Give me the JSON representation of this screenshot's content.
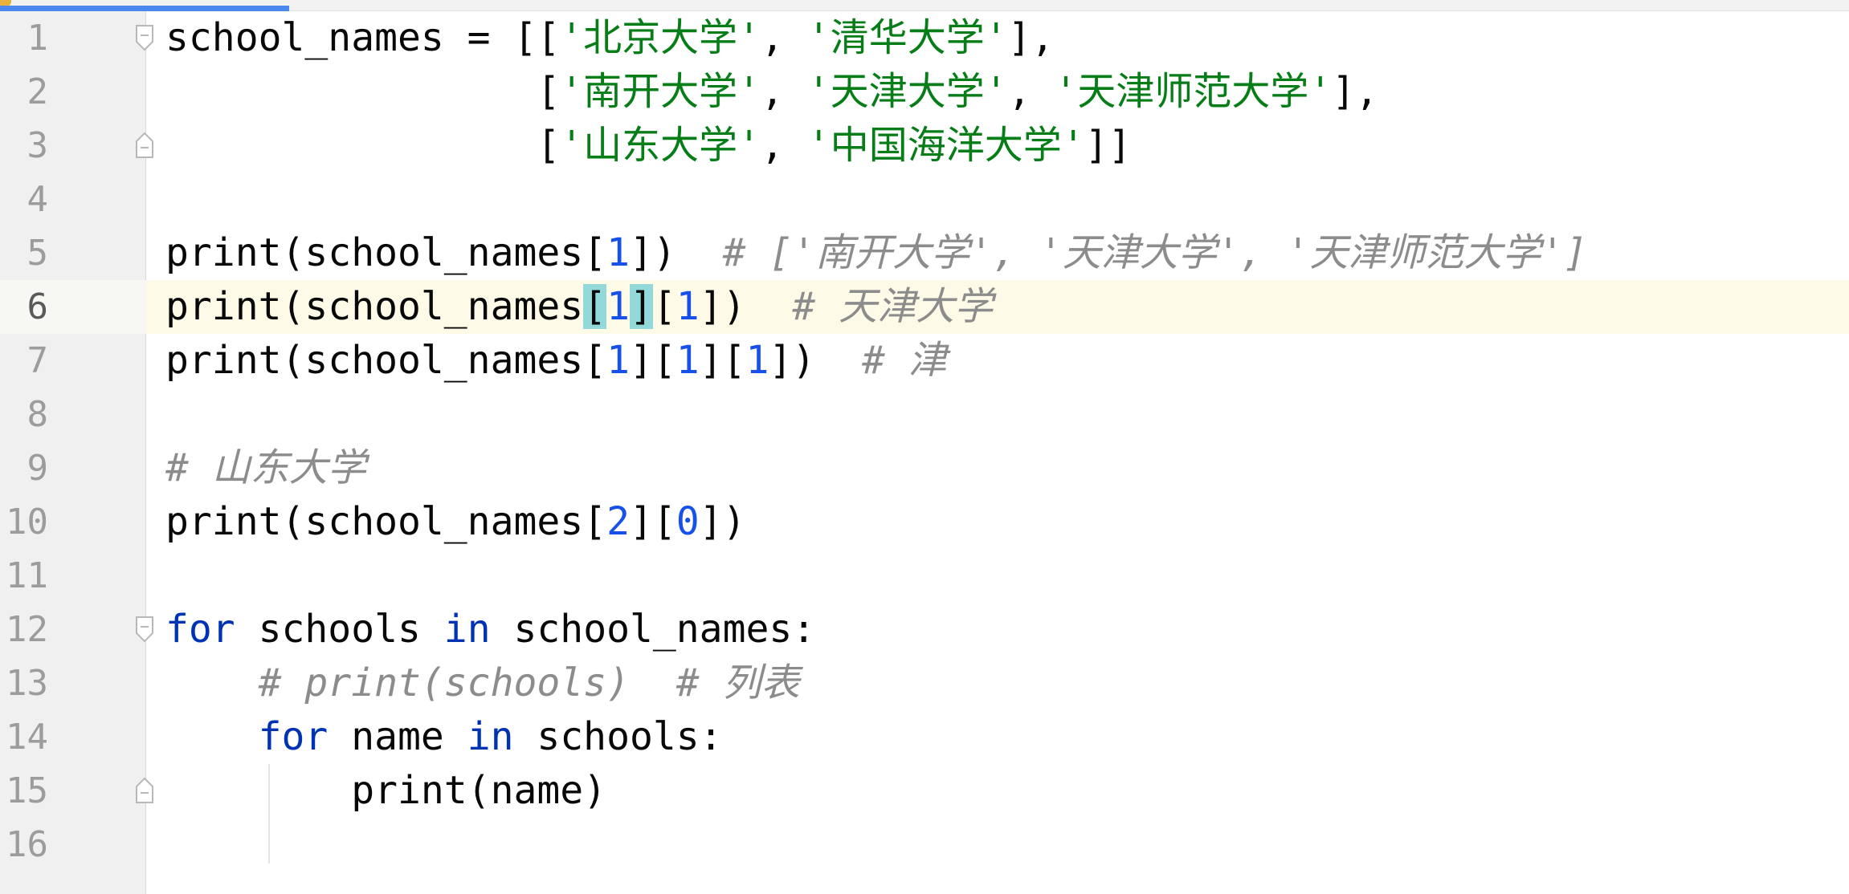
{
  "editor": {
    "current_line": 6,
    "lines": [
      {
        "number": "1",
        "tokens": [
          {
            "text": "school_names = [[",
            "kind": "default"
          },
          {
            "text": "'北京大学'",
            "kind": "string"
          },
          {
            "text": ", ",
            "kind": "default"
          },
          {
            "text": "'清华大学'",
            "kind": "string"
          },
          {
            "text": "],",
            "kind": "default"
          }
        ]
      },
      {
        "number": "2",
        "tokens": [
          {
            "text": "                [",
            "kind": "default"
          },
          {
            "text": "'南开大学'",
            "kind": "string"
          },
          {
            "text": ", ",
            "kind": "default"
          },
          {
            "text": "'天津大学'",
            "kind": "string"
          },
          {
            "text": ", ",
            "kind": "default"
          },
          {
            "text": "'天津师范大学'",
            "kind": "string"
          },
          {
            "text": "],",
            "kind": "default"
          }
        ]
      },
      {
        "number": "3",
        "tokens": [
          {
            "text": "                [",
            "kind": "default"
          },
          {
            "text": "'山东大学'",
            "kind": "string"
          },
          {
            "text": ", ",
            "kind": "default"
          },
          {
            "text": "'中国海洋大学'",
            "kind": "string"
          },
          {
            "text": "]]",
            "kind": "default"
          }
        ]
      },
      {
        "number": "4",
        "tokens": []
      },
      {
        "number": "5",
        "tokens": [
          {
            "text": "print(school_names[",
            "kind": "default"
          },
          {
            "text": "1",
            "kind": "number"
          },
          {
            "text": "])  ",
            "kind": "default"
          },
          {
            "text": "# ['南开大学', '天津大学', '天津师范大学']",
            "kind": "comment"
          }
        ]
      },
      {
        "number": "6",
        "tokens": [
          {
            "text": "print(school_names",
            "kind": "default"
          },
          {
            "text": "[",
            "kind": "default",
            "match": true
          },
          {
            "text": "1",
            "kind": "number"
          },
          {
            "text": "]",
            "kind": "default",
            "match": true
          },
          {
            "text": "[",
            "kind": "default"
          },
          {
            "text": "1",
            "kind": "number"
          },
          {
            "text": "])  ",
            "kind": "default"
          },
          {
            "text": "# 天津大学",
            "kind": "comment"
          }
        ]
      },
      {
        "number": "7",
        "tokens": [
          {
            "text": "print(school_names[",
            "kind": "default"
          },
          {
            "text": "1",
            "kind": "number"
          },
          {
            "text": "][",
            "kind": "default"
          },
          {
            "text": "1",
            "kind": "number"
          },
          {
            "text": "][",
            "kind": "default"
          },
          {
            "text": "1",
            "kind": "number"
          },
          {
            "text": "])  ",
            "kind": "default"
          },
          {
            "text": "# 津",
            "kind": "comment"
          }
        ]
      },
      {
        "number": "8",
        "tokens": []
      },
      {
        "number": "9",
        "tokens": [
          {
            "text": "# 山东大学",
            "kind": "comment"
          }
        ]
      },
      {
        "number": "10",
        "tokens": [
          {
            "text": "print(school_names[",
            "kind": "default"
          },
          {
            "text": "2",
            "kind": "number"
          },
          {
            "text": "][",
            "kind": "default"
          },
          {
            "text": "0",
            "kind": "number"
          },
          {
            "text": "])",
            "kind": "default"
          }
        ]
      },
      {
        "number": "11",
        "tokens": []
      },
      {
        "number": "12",
        "tokens": [
          {
            "text": "for",
            "kind": "keyword"
          },
          {
            "text": " schools ",
            "kind": "default"
          },
          {
            "text": "in",
            "kind": "keyword"
          },
          {
            "text": " school_names:",
            "kind": "default"
          }
        ]
      },
      {
        "number": "13",
        "tokens": [
          {
            "text": "    ",
            "kind": "default"
          },
          {
            "text": "# print(schools)  # 列表",
            "kind": "comment"
          }
        ]
      },
      {
        "number": "14",
        "tokens": [
          {
            "text": "    ",
            "kind": "default"
          },
          {
            "text": "for",
            "kind": "keyword"
          },
          {
            "text": " name ",
            "kind": "default"
          },
          {
            "text": "in",
            "kind": "keyword"
          },
          {
            "text": " schools:",
            "kind": "default"
          }
        ]
      },
      {
        "number": "15",
        "tokens": [
          {
            "text": "        print(name)",
            "kind": "default"
          }
        ]
      },
      {
        "number": "16",
        "tokens": []
      }
    ]
  }
}
